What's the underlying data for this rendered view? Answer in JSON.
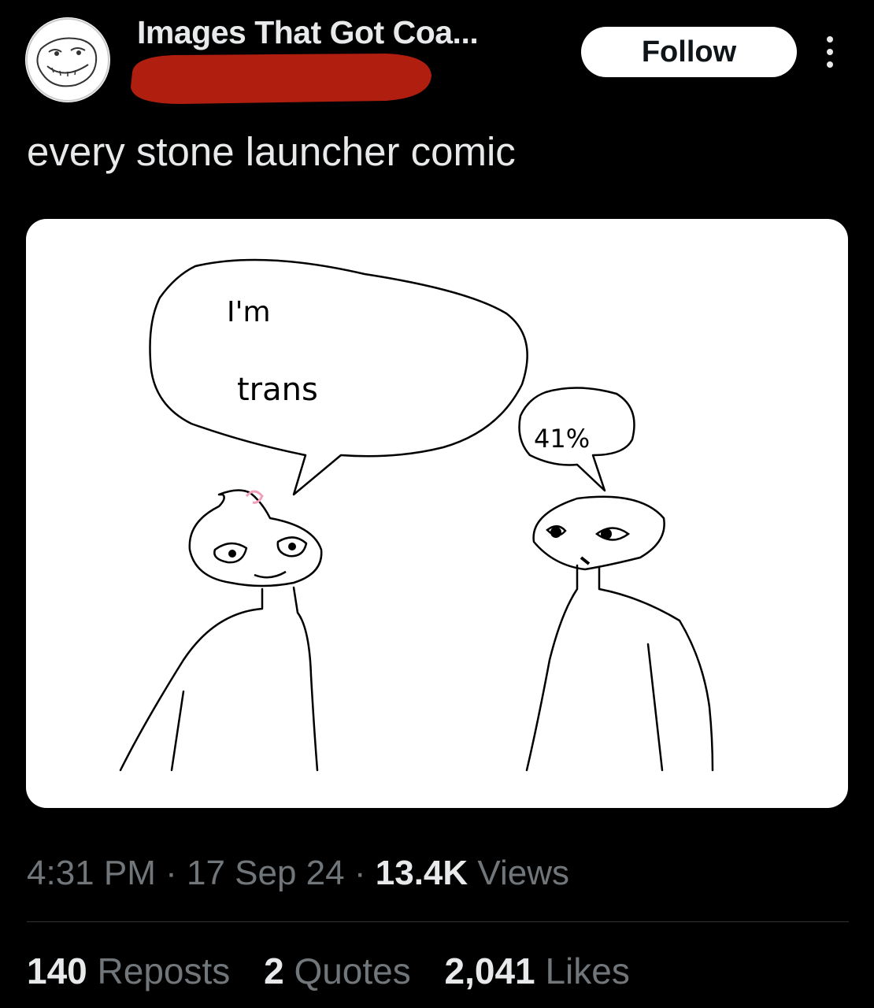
{
  "header": {
    "display_name": "Images That Got Coa...",
    "avatar_icon": "troll-face-avatar-icon",
    "redaction_color": "#b01e10",
    "follow_label": "Follow",
    "more_icon": "more-vertical-icon"
  },
  "tweet": {
    "text": "every stone launcher comic"
  },
  "comic": {
    "left_bubble_line1": "I'm",
    "left_bubble_line2": "trans",
    "right_bubble": "41%"
  },
  "meta": {
    "time": "4:31 PM",
    "date": "17 Sep 24",
    "views_count": "13.4K",
    "views_label": "Views"
  },
  "stats": {
    "reposts_count": "140",
    "reposts_label": "Reposts",
    "quotes_count": "2",
    "quotes_label": "Quotes",
    "likes_count": "2,041",
    "likes_label": "Likes"
  },
  "colors": {
    "background": "#000000",
    "text_primary": "#e7e9ea",
    "text_secondary": "#71767b",
    "divider": "#2f3336"
  }
}
